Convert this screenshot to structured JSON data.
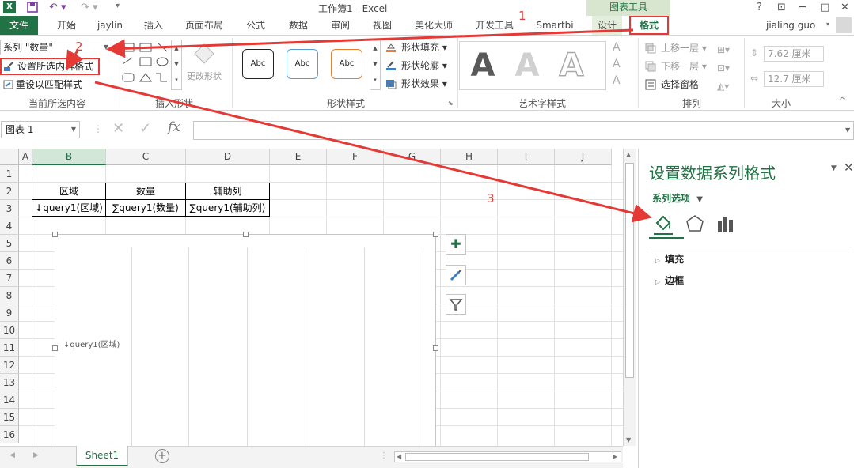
{
  "window": {
    "title": "工作簿1 - Excel",
    "context_tab": "图表工具",
    "user": "jialing guo",
    "help": "?",
    "controls": [
      "⊡",
      "─",
      "□",
      "✕"
    ]
  },
  "tabs": [
    "文件",
    "开始",
    "jaylin",
    "插入",
    "页面布局",
    "公式",
    "数据",
    "审阅",
    "视图",
    "美化大师",
    "开发工具",
    "Smartbi",
    "设计",
    "格式"
  ],
  "ribbon": {
    "selection_dropdown": "系列 \"数量\"",
    "format_selection": "设置所选内容格式",
    "reset_to_match": "重设以匹配样式",
    "group_current": "当前所选内容",
    "group_insert_shapes": "插入形状",
    "change_shape": "更改形状",
    "style_labels": [
      "Abc",
      "Abc",
      "Abc"
    ],
    "shape_fill": "形状填充",
    "shape_outline": "形状轮廓",
    "shape_effects": "形状效果",
    "group_shape_styles": "形状样式",
    "wordart_letters": [
      "A",
      "A",
      "A"
    ],
    "group_wordart": "艺术字样式",
    "bring_forward": "上移一层",
    "send_backward": "下移一层",
    "selection_pane": "选择窗格",
    "group_arrange": "排列",
    "height": "7.62 厘米",
    "width": "12.7 厘米",
    "group_size": "大小"
  },
  "formula_bar": {
    "name_box": "图表 1",
    "fx": "fx",
    "value": ""
  },
  "sheet": {
    "columns": [
      "A",
      "B",
      "C",
      "D",
      "E",
      "F",
      "G",
      "H",
      "I",
      "J"
    ],
    "rows": [
      "1",
      "2",
      "3",
      "4",
      "5",
      "6",
      "7",
      "8",
      "9",
      "10",
      "11",
      "12",
      "13",
      "14",
      "15",
      "16"
    ],
    "header_row": [
      "区域",
      "数量",
      "辅助列"
    ],
    "data_row": [
      "↓query1(区域)",
      "∑query1(数量)",
      "∑query1(辅助列)"
    ],
    "chart_axis_label": "↓query1(区域)",
    "tab": "Sheet1"
  },
  "pane": {
    "title": "设置数据系列格式",
    "subtitle": "系列选项",
    "sections": [
      "填充",
      "边框"
    ]
  },
  "annotations": [
    "1",
    "2",
    "3"
  ],
  "colors": {
    "excel_green": "#217346",
    "annotation_red": "#e53935"
  }
}
